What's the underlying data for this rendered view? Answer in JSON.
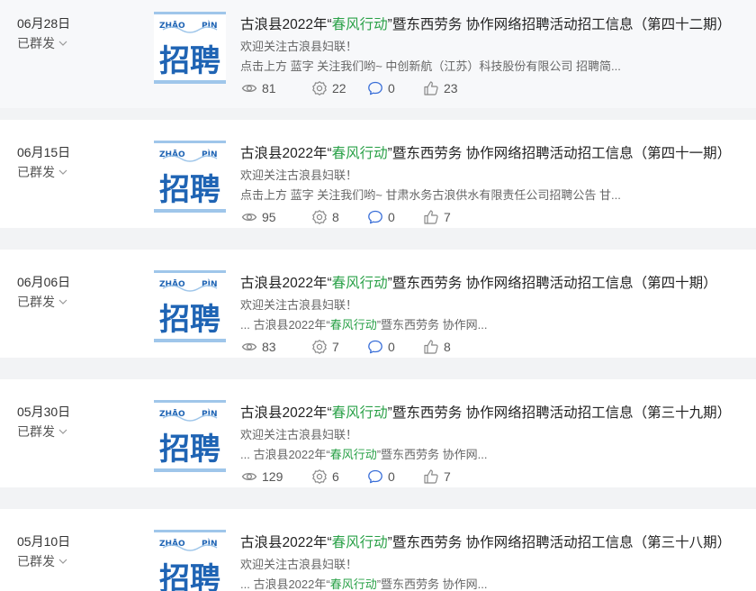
{
  "posts": [
    {
      "date": "06月28日",
      "status": "已群发",
      "title_before": "古浪县2022年“",
      "title_highlight": "春风行动",
      "title_after": "”暨东西劳务 协作网络招聘活动招工信息（第四十二期）",
      "line1": "欢迎关注古浪县妇联！",
      "line2_before": "点击上方 蓝字 关注我们哟~ 中创新航（江苏）科技股份有限公司 招聘简...",
      "line2_highlight": "",
      "line2_after": "",
      "views": "81",
      "shares": "22",
      "comments": "0",
      "likes": "23"
    },
    {
      "date": "06月15日",
      "status": "已群发",
      "title_before": "古浪县2022年“",
      "title_highlight": "春风行动",
      "title_after": "”暨东西劳务 协作网络招聘活动招工信息（第四十一期）",
      "line1": "欢迎关注古浪县妇联！",
      "line2_before": "点击上方 蓝字 关注我们哟~ 甘肃水务古浪供水有限责任公司招聘公告 甘...",
      "line2_highlight": "",
      "line2_after": "",
      "views": "95",
      "shares": "8",
      "comments": "0",
      "likes": "7"
    },
    {
      "date": "06月06日",
      "status": "已群发",
      "title_before": "古浪县2022年“",
      "title_highlight": "春风行动",
      "title_after": "”暨东西劳务 协作网络招聘活动招工信息（第四十期）",
      "line1": "欢迎关注古浪县妇联！",
      "line2_before": "... 古浪县2022年“",
      "line2_highlight": "春风行动",
      "line2_after": "”暨东西劳务 协作网...",
      "views": "83",
      "shares": "7",
      "comments": "0",
      "likes": "8"
    },
    {
      "date": "05月30日",
      "status": "已群发",
      "title_before": "古浪县2022年“",
      "title_highlight": "春风行动",
      "title_after": "”暨东西劳务 协作网络招聘活动招工信息（第三十九期）",
      "line1": "欢迎关注古浪县妇联！",
      "line2_before": "... 古浪县2022年“",
      "line2_highlight": "春风行动",
      "line2_after": "”暨东西劳务 协作网...",
      "views": "129",
      "shares": "6",
      "comments": "0",
      "likes": "7"
    },
    {
      "date": "05月10日",
      "status": "已群发",
      "title_before": "古浪县2022年“",
      "title_highlight": "春风行动",
      "title_after": "”暨东西劳务 协作网络招聘活动招工信息（第三十八期）",
      "line1": "欢迎关注古浪县妇联！",
      "line2_before": "... 古浪县2022年“",
      "line2_highlight": "春风行动",
      "line2_after": "”暨东西劳务 协作网...",
      "views": "",
      "shares": "",
      "comments": "",
      "likes": ""
    }
  ],
  "thumbnail": {
    "pinyin_left": "ZHĀO",
    "pinyin_right": "PÌN",
    "chars": "招聘",
    "color_main": "#1f64b4",
    "color_band": "#9fc6ea"
  },
  "icons": {
    "views": "eye-icon",
    "shares": "share-gear-icon",
    "comments": "comment-bubble-icon",
    "likes": "thumbs-up-icon",
    "status": "chevron-down-icon"
  },
  "colors": {
    "highlight": "#2aa148",
    "background": "#f2f3f5",
    "card": "#ffffff"
  }
}
